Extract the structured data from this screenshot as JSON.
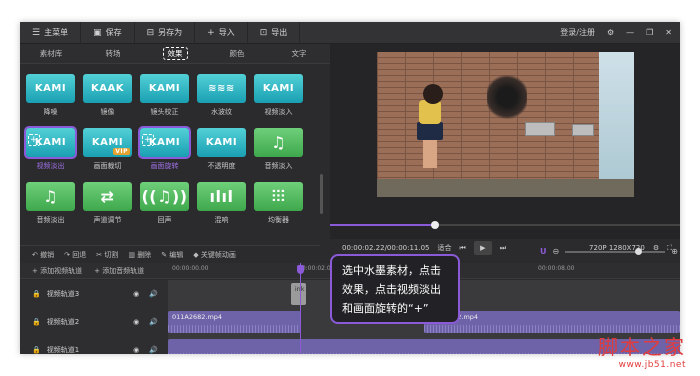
{
  "titlebar": {
    "items": [
      {
        "icon": "menu-icon",
        "glyph": "☰",
        "label": "主菜单"
      },
      {
        "icon": "save-icon",
        "glyph": "▣",
        "label": "保存"
      },
      {
        "icon": "save-as-icon",
        "glyph": "⊟",
        "label": "另存为"
      },
      {
        "icon": "import-icon",
        "glyph": "+",
        "label": "导入"
      },
      {
        "icon": "export-icon",
        "glyph": "⊡",
        "label": "导出"
      }
    ],
    "login": "登录/注册"
  },
  "tabs": [
    "素材库",
    "转场",
    "效果",
    "颜色",
    "文字"
  ],
  "effects": {
    "cut_labels": [
      "",
      "",
      "",
      "",
      ""
    ],
    "items": [
      {
        "thumb": "KAMI",
        "label": "降噪"
      },
      {
        "thumb": "KAAK",
        "label": "镜像"
      },
      {
        "thumb": "KAMI",
        "label": "镜头校正"
      },
      {
        "thumb": "≋≋≋",
        "label": "水波纹"
      },
      {
        "thumb": "KAMI",
        "label": "视频淡入"
      },
      {
        "thumb": "KAMI",
        "label": "视频淡出",
        "selected": true,
        "plus": true
      },
      {
        "thumb": "KAMI",
        "label": "画面裁切",
        "vip": "VIP"
      },
      {
        "thumb": "KAMI",
        "label": "画面旋转",
        "selected": true,
        "plus": true
      },
      {
        "thumb": "KAMI",
        "label": "不透明度"
      },
      {
        "thumb": "♫",
        "label": "音频淡入",
        "green": true
      },
      {
        "thumb": "♫",
        "label": "音频淡出",
        "green": true
      },
      {
        "thumb": "⇄",
        "label": "声道调节",
        "green": true
      },
      {
        "thumb": "((♫))",
        "label": "回声",
        "green": true
      },
      {
        "thumb": "ılıl",
        "label": "混响",
        "green": true
      },
      {
        "thumb": "⫶⫶⫶",
        "label": "均衡器",
        "green": true
      }
    ]
  },
  "player": {
    "time": "00:00:02.22/00:00:11.05",
    "fit": "适合",
    "resolution": "720P 1280X720",
    "progress": 0.3
  },
  "toolbar": [
    "撤销",
    "回退",
    "切割",
    "删除",
    "编辑",
    "关键帧动画"
  ],
  "track_header": [
    "添加视频轨道",
    "添加音频轨道"
  ],
  "ruler_ticks": [
    "00:00:00.00",
    "00:00:02.00"
  ],
  "ruler_right": "00:00:08.00",
  "tracks": [
    {
      "name": "视频轨道3",
      "clips": [
        {
          "text": "ink",
          "kind": "text",
          "start": 0.24,
          "len": 0.03
        }
      ]
    },
    {
      "name": "视频轨道2",
      "clips": [
        {
          "text": "011A2682.mp4",
          "kind": "video",
          "start": 0.0,
          "len": 0.26
        },
        {
          "text": "011A2682.mp4",
          "kind": "video",
          "start": 0.5,
          "len": 0.5
        }
      ]
    },
    {
      "name": "视频轨道1",
      "clips": [
        {
          "text": "",
          "kind": "video",
          "start": 0.0,
          "len": 1.0
        }
      ]
    }
  ],
  "callout": {
    "line1": "选中水墨素材，点击",
    "line2": "效果，点击视频淡出",
    "line3": "和画面旋转的“+”"
  },
  "watermark": {
    "big": "脚本之家",
    "small": "www.jb51.net"
  },
  "colors": {
    "accent": "#8a5ad8",
    "effect_teal": "#33b8c4",
    "effect_green": "#52bd61",
    "watermark": "#e23b3b"
  }
}
